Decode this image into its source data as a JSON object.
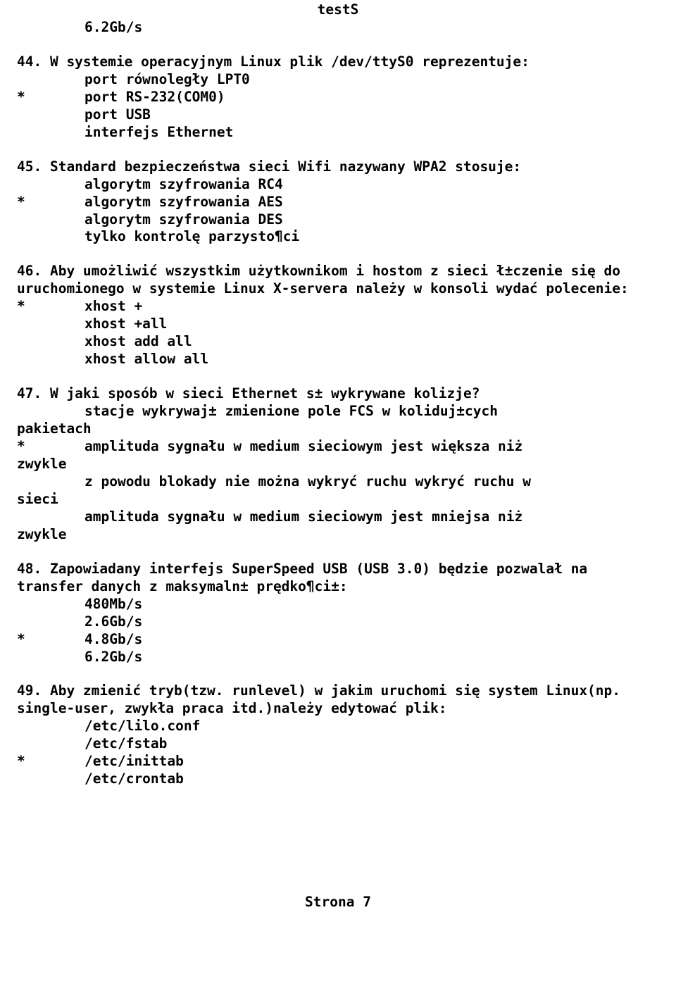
{
  "header_title": "testS",
  "orphan_answer": "6.2Gb/s",
  "q44": {
    "prompt": "44. W systemie operacyjnym Linux plik /dev/ttyS0 reprezentuje:",
    "a1": "port równoległy LPT0",
    "a2_marker": "*",
    "a2": "port RS-232(COM0)",
    "a3": "port USB",
    "a4": "interfejs Ethernet"
  },
  "q45": {
    "prompt": "45. Standard bezpieczeństwa sieci Wifi nazywany WPA2 stosuje:",
    "a1": "algorytm szyfrowania RC4",
    "a2_marker": "*",
    "a2": "algorytm szyfrowania AES",
    "a3": "algorytm szyfrowania DES",
    "a4": "tylko kontrolę parzysto¶ci"
  },
  "q46": {
    "prompt": "46. Aby umożliwić wszystkim użytkownikom i hostom z sieci ł±czenie się do uruchomionego w systemie Linux X-servera należy w konsoli wydać polecenie:",
    "a1_marker": "*",
    "a1": "xhost +",
    "a2": "xhost +all",
    "a3": "xhost add all",
    "a4": "xhost allow all"
  },
  "q47": {
    "prompt": "47. W jaki sposób w sieci Ethernet s± wykrywane kolizje?",
    "a1_line1": "stacje wykrywaj± zmienione pole FCS w koliduj±cych",
    "a1_line2": "pakietach",
    "a2_marker": "*",
    "a2_line1": "amplituda sygnału w medium sieciowym jest większa niż",
    "a2_line2": "zwykle",
    "a3_line1": "z powodu blokady nie można wykryć ruchu wykryć ruchu w",
    "a3_line2": "sieci",
    "a4_line1": "amplituda sygnału w medium sieciowym jest mniejsa niż",
    "a4_line2": "zwykle"
  },
  "q48": {
    "prompt": "48. Zapowiadany interfejs SuperSpeed USB (USB 3.0) będzie pozwalał na transfer danych z maksymaln± prędko¶ci±:",
    "a1": "480Mb/s",
    "a2": "2.6Gb/s",
    "a3_marker": "*",
    "a3": "4.8Gb/s",
    "a4": "6.2Gb/s"
  },
  "q49": {
    "prompt": "49. Aby zmienić tryb(tzw. runlevel) w jakim uruchomi się system Linux(np. single-user, zwykła praca itd.)należy edytować plik:",
    "a1": "/etc/lilo.conf",
    "a2": "/etc/fstab",
    "a3_marker": "*",
    "a3": "/etc/inittab",
    "a4": "/etc/crontab"
  },
  "footer": "Strona 7"
}
